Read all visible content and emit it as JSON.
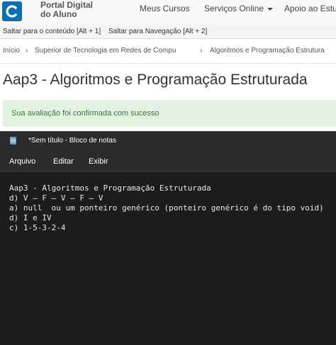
{
  "portal": {
    "brand_line1": "Portal Digital",
    "brand_line2": "do Aluno",
    "nav": [
      "Meus Cursos",
      "Serviços Online",
      "Apoio ao Estu"
    ],
    "accent_color": "#0a6fb2"
  },
  "skiplinks": [
    "Saltar para o conteúdo [Alt + 1]",
    "Saltar para Navegação [Alt + 2]"
  ],
  "breadcrumb": [
    "Início",
    "Superior de Tecnologia em Redes de Compu",
    "Algoritmos e Programação Estrutura"
  ],
  "page_title": "Aap3 - Algoritmos e Programação Estruturada",
  "alert": {
    "message": "Sua avaliação foi confirmada com sucesso",
    "color": "#3c763d",
    "background": "#e3f2e1"
  },
  "notepad": {
    "title": "*Sem título - Bloco de notas",
    "menu": [
      "Arquivo",
      "Editar",
      "Exibir"
    ],
    "lines": [
      "Aap3 - Algoritmos e Programação Estruturada",
      "d) V – F – V – F – V",
      "a) null  ou um ponteiro genérico (ponteiro genérico é do tipo void)",
      "d) I e IV",
      "c) 1-5-3-2-4"
    ]
  }
}
